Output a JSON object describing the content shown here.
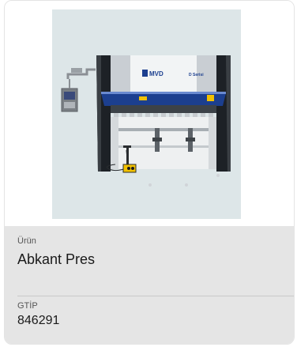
{
  "product_image": {
    "brand_text": "MVD",
    "series_text": "D Serisi"
  },
  "fields": [
    {
      "label": "Ürün",
      "value": "Abkant Pres"
    },
    {
      "label": "GTİP",
      "value": "846291"
    }
  ],
  "colors": {
    "info_background": "#e5e5e5",
    "image_background": "#dde6e8",
    "brand_blue": "#1c3f8f",
    "accent_yellow": "#f2c100"
  }
}
